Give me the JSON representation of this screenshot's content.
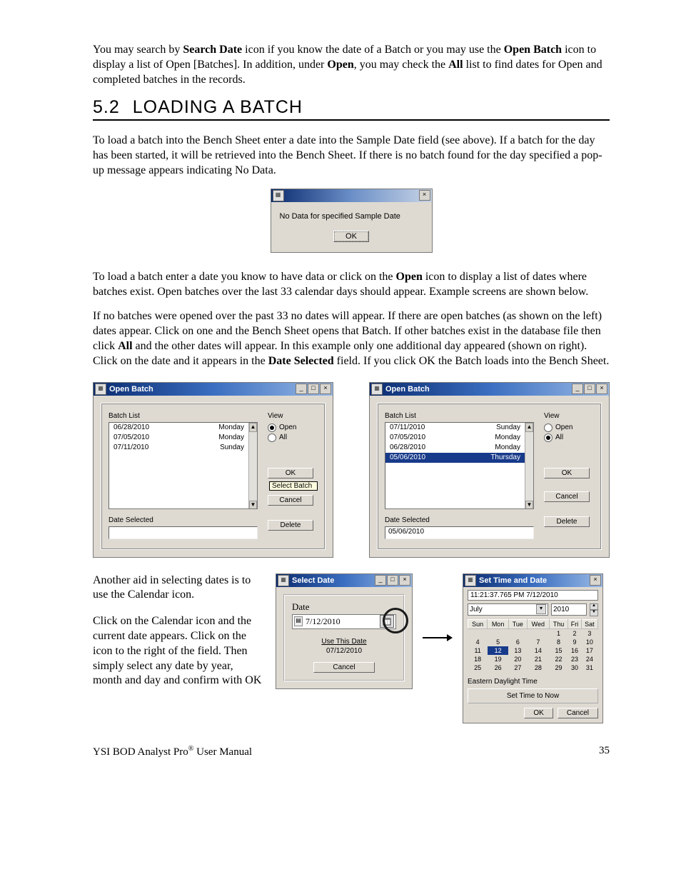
{
  "intro": {
    "p1_a": "You may search by ",
    "p1_b": "Search Date",
    "p1_c": " icon if you know the date of a Batch or you may use the ",
    "p1_d": "Open Batch",
    "p1_e": " icon to display a list of Open [Batches]. In addition, under ",
    "p1_f": "Open",
    "p1_g": ", you may check the ",
    "p1_h": "All",
    "p1_i": " list to find dates for Open and completed batches in the records."
  },
  "heading": {
    "num": "5.2",
    "title": "LOADING A BATCH"
  },
  "para2": "To load a batch into the Bench Sheet enter a date into the Sample Date field (see above). If a batch for the day has been started, it will be retrieved into the Bench Sheet. If there is no batch found for the day specified a pop-up message appears indicating No Data.",
  "nodata": {
    "msg": "No Data for specified Sample Date",
    "ok": "OK"
  },
  "para3": {
    "a": "To load a batch enter a date you know to have data or click on the ",
    "b": "Open",
    "c": " icon to display a list of dates where batches exist. Open batches over the last 33 calendar days should appear. Example screens are shown below."
  },
  "para4": {
    "a": "If no batches were opened over the past 33 no dates will appear. If there are open batches (as shown on the left) dates appear. Click on one and the Bench Sheet opens that Batch. If other batches exist in the database file then click ",
    "b": "All",
    "c": " and the other dates will appear. In this example only one additional day appeared (shown on right). Click on the date and it appears in the ",
    "d": "Date Selected",
    "e": " field. If you click OK the Batch loads into the Bench Sheet."
  },
  "openbatch_common": {
    "title": "Open Batch",
    "batchlist_label": "Batch List",
    "view_label": "View",
    "open_label": "Open",
    "all_label": "All",
    "ok": "OK",
    "cancel": "Cancel",
    "delete": "Delete",
    "dateselected_label": "Date Selected",
    "tooltip": "Select Batch"
  },
  "openbatch_left": {
    "rows": [
      {
        "date": "06/28/2010",
        "day": "Monday",
        "selected": false
      },
      {
        "date": "07/05/2010",
        "day": "Monday",
        "selected": false
      },
      {
        "date": "07/11/2010",
        "day": "Sunday",
        "selected": false
      }
    ],
    "view_selected": "Open",
    "date_selected_value": ""
  },
  "openbatch_right": {
    "rows": [
      {
        "date": "07/11/2010",
        "day": "Sunday",
        "selected": false
      },
      {
        "date": "07/05/2010",
        "day": "Monday",
        "selected": false
      },
      {
        "date": "06/28/2010",
        "day": "Monday",
        "selected": false
      },
      {
        "date": "05/06/2010",
        "day": "Thursday",
        "selected": true
      }
    ],
    "view_selected": "All",
    "date_selected_value": "05/06/2010"
  },
  "para5": "Another aid in selecting dates is to use the Calendar icon.",
  "para6": "Click on the Calendar icon and the current date appears. Click on the icon to the right of the field. Then simply select any date by year, month and day and confirm with OK",
  "selectdate": {
    "title": "Select Date",
    "date_label": "Date",
    "date_value": "7/12/2010",
    "use_this_date": "Use This Date",
    "shown_date": "07/12/2010",
    "cancel": "Cancel"
  },
  "settime": {
    "title": "Set Time and Date",
    "timestamp": "11:21:37.765 PM 7/12/2010",
    "month": "July",
    "year": "2010",
    "days": [
      "Sun",
      "Mon",
      "Tue",
      "Wed",
      "Thu",
      "Fri",
      "Sat"
    ],
    "grid": [
      [
        "",
        "",
        "",
        "",
        "1",
        "2",
        "3"
      ],
      [
        "4",
        "5",
        "6",
        "7",
        "8",
        "9",
        "10"
      ],
      [
        "11",
        "12",
        "13",
        "14",
        "15",
        "16",
        "17"
      ],
      [
        "18",
        "19",
        "20",
        "21",
        "22",
        "23",
        "24"
      ],
      [
        "25",
        "26",
        "27",
        "28",
        "29",
        "30",
        "31"
      ]
    ],
    "selected_day": "12",
    "tz": "Eastern Daylight Time",
    "set_now": "Set Time to Now",
    "ok": "OK",
    "cancel": "Cancel"
  },
  "footer": {
    "left_a": "YSI BOD Analyst Pro",
    "left_b": " User Manual",
    "page": "35"
  }
}
